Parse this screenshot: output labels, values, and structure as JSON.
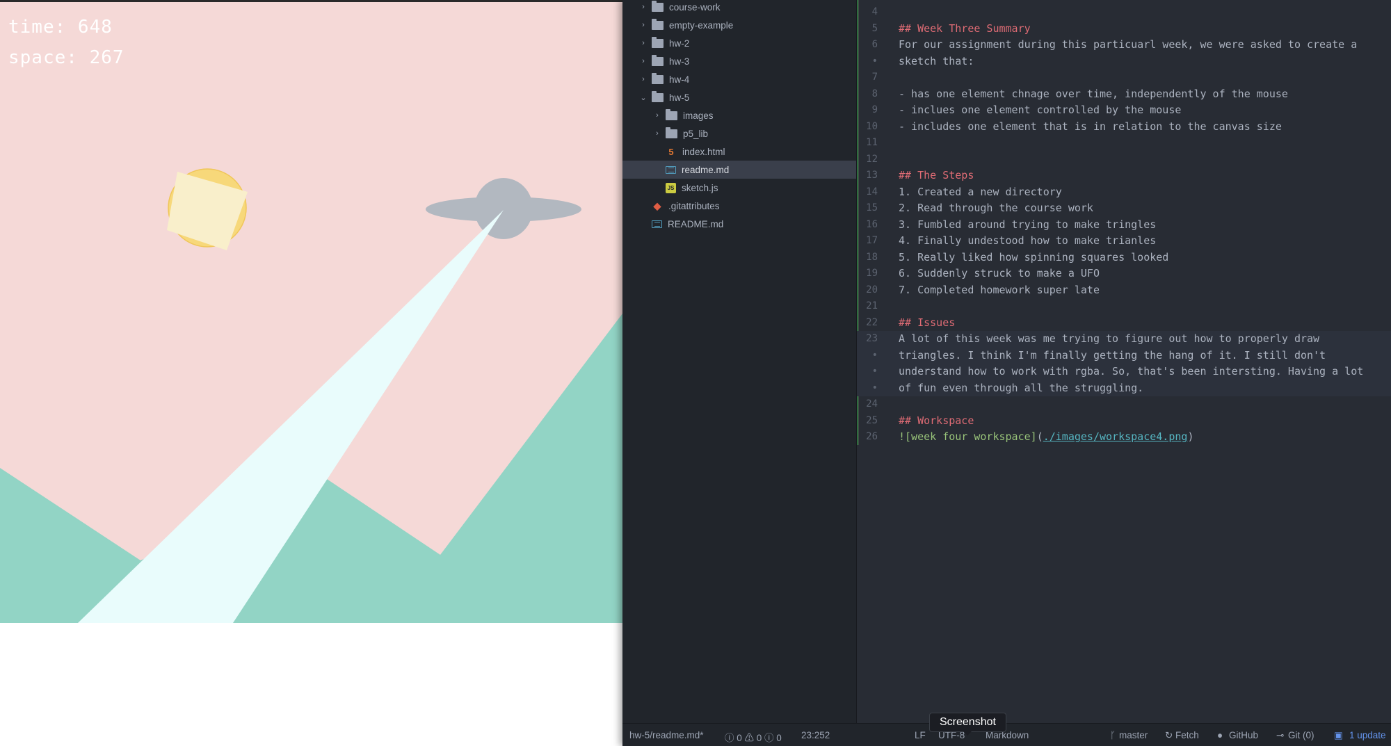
{
  "sketch": {
    "time_text": "time: 648",
    "space_text": "space: 267",
    "colors": {
      "sky": "#f5d9d7",
      "mountains": "#92d4c5",
      "sun": "#f7d87a",
      "sun_square": "#f9efcb",
      "ufo": "#b2b8c0",
      "beam": "#e9fcfc"
    }
  },
  "tree": {
    "items": [
      {
        "label": "course-work",
        "type": "folder",
        "expanded": false
      },
      {
        "label": "empty-example",
        "type": "folder",
        "expanded": false
      },
      {
        "label": "hw-2",
        "type": "folder",
        "expanded": false
      },
      {
        "label": "hw-3",
        "type": "folder",
        "expanded": false
      },
      {
        "label": "hw-4",
        "type": "folder",
        "expanded": false
      },
      {
        "label": "hw-5",
        "type": "folder",
        "expanded": true
      },
      {
        "label": "images",
        "type": "folder",
        "expanded": false
      },
      {
        "label": "p5_lib",
        "type": "folder",
        "expanded": false
      },
      {
        "label": "index.html",
        "type": "html-file"
      },
      {
        "label": "readme.md",
        "type": "markdown-file",
        "selected": true
      },
      {
        "label": "sketch.js",
        "type": "js-file"
      },
      {
        "label": ".gitattributes",
        "type": "git-file"
      },
      {
        "label": "README.md",
        "type": "markdown-file"
      }
    ]
  },
  "code": {
    "lines": [
      {
        "num": "4",
        "text": ""
      },
      {
        "num": "5",
        "text": "## Week Three Summary",
        "kind": "heading"
      },
      {
        "num": "6",
        "text": "For our assignment during this particuarl week, we were asked to create a"
      },
      {
        "num": "•",
        "text": "sketch that:"
      },
      {
        "num": "7",
        "text": ""
      },
      {
        "num": "8",
        "text": "- has one element chnage over time, independently of the mouse"
      },
      {
        "num": "9",
        "text": "- inclues one element controlled by the mouse"
      },
      {
        "num": "10",
        "text": "- includes one element that is in relation to the canvas size"
      },
      {
        "num": "11",
        "text": ""
      },
      {
        "num": "12",
        "text": ""
      },
      {
        "num": "13",
        "text": "## The Steps",
        "kind": "heading"
      },
      {
        "num": "14",
        "text": "1. Created a new directory"
      },
      {
        "num": "15",
        "text": "2. Read through the course work"
      },
      {
        "num": "16",
        "text": "3. Fumbled around trying to make tringles"
      },
      {
        "num": "17",
        "text": "4. Finally undestood how to make trianles"
      },
      {
        "num": "18",
        "text": "5. Really liked how spinning squares looked"
      },
      {
        "num": "19",
        "text": "6. Suddenly struck to make a UFO"
      },
      {
        "num": "20",
        "text": "7. Completed homework super late"
      },
      {
        "num": "21",
        "text": ""
      },
      {
        "num": "22",
        "text": "## Issues",
        "kind": "heading"
      },
      {
        "num": "23",
        "text": "A lot of this week was me trying to figure out how to properly draw",
        "cursor": true
      },
      {
        "num": "•",
        "text": "triangles. I think I'm finally getting the hang of it. I still don't",
        "cursor": true
      },
      {
        "num": "•",
        "text": "understand how to work with rgba. So, that's been intersting. Having a lot",
        "cursor": true
      },
      {
        "num": "•",
        "text": "of fun even through all the struggling.",
        "cursor": true
      },
      {
        "num": "24",
        "text": ""
      },
      {
        "num": "25",
        "text": "## Workspace",
        "kind": "heading"
      },
      {
        "num": "26",
        "kind": "image-link",
        "alt": "![week four workspace]",
        "open": "(",
        "url": "./images/workspace4.png",
        "close": ")"
      }
    ]
  },
  "status": {
    "file": "hw-5/readme.md*",
    "diagnostics": "ⓘ 0 ⚠ 0 ⓘ 0",
    "position": "23:252",
    "line_ending": "LF",
    "encoding": "UTF-8",
    "grammar": "Markdown",
    "branch": "master",
    "fetch": "Fetch",
    "github": "GitHub",
    "git": "Git (0)",
    "update": "1 update",
    "tooltip": "Screenshot"
  }
}
